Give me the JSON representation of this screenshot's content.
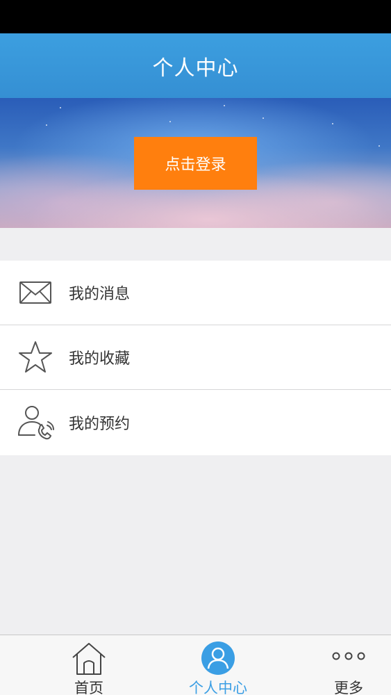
{
  "nav": {
    "title": "个人中心"
  },
  "banner": {
    "login_label": "点击登录"
  },
  "menu": {
    "items": [
      {
        "label": "我的消息",
        "icon": "envelope-icon"
      },
      {
        "label": "我的收藏",
        "icon": "star-icon"
      },
      {
        "label": "我的预约",
        "icon": "user-phone-icon"
      }
    ]
  },
  "tabbar": {
    "items": [
      {
        "label": "首页",
        "icon": "home-icon"
      },
      {
        "label": "个人中心",
        "icon": "user-icon",
        "active": true
      },
      {
        "label": "更多",
        "icon": "more-icon"
      }
    ],
    "active_color": "#3a9ee4"
  },
  "colors": {
    "nav": "#3c9fe0",
    "login_button": "#ff7f0e"
  }
}
